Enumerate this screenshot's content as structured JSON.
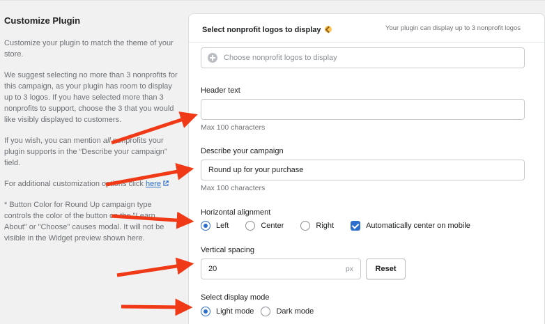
{
  "left": {
    "title": "Customize Plugin",
    "p1": "Customize your plugin to match the theme of your store.",
    "p2": "We suggest selecting no more than 3 nonprofits for this campaign, as your plugin has room to display up to 3 logos. If you have selected more than 3 nonprofits to support, choose the 3 that you would like visibly displayed to customers.",
    "p3_a": "If you wish, you can mention ",
    "p3_em": "all",
    "p3_b": " nonprofits your plugin supports in the “Describe your campaign” field.",
    "p4_a": "For additional customization options click ",
    "p4_link": "here",
    "p5": "* Button Color for Round Up campaign type controls the color of the button on the \"Learn About\" or \"Choose\" causes modal. It will not be visible in the Widget preview shown here."
  },
  "card": {
    "title": "Select nonprofit logos to display",
    "note": "Your plugin can display up to 3 nonprofit logos",
    "choose_placeholder": "Choose nonprofit logos to display",
    "header_label": "Header text",
    "header_value": "",
    "header_help": "Max 100 characters",
    "describe_label": "Describe your campaign",
    "describe_value": "Round up for your purchase",
    "describe_help": "Max 100 characters",
    "halign_label": "Horizontal alignment",
    "halign_options": [
      "Left",
      "Center",
      "Right"
    ],
    "halign_selected": "Left",
    "auto_center_label": "Automatically center on mobile",
    "vspacing_label": "Vertical spacing",
    "vspacing_value": "20",
    "vspacing_unit": "px",
    "reset_label": "Reset",
    "mode_label": "Select display mode",
    "mode_options": [
      "Light mode",
      "Dark mode"
    ],
    "mode_selected": "Light mode"
  },
  "colors": {
    "accent": "#2c6ecb",
    "arrow": "#f03a17"
  }
}
